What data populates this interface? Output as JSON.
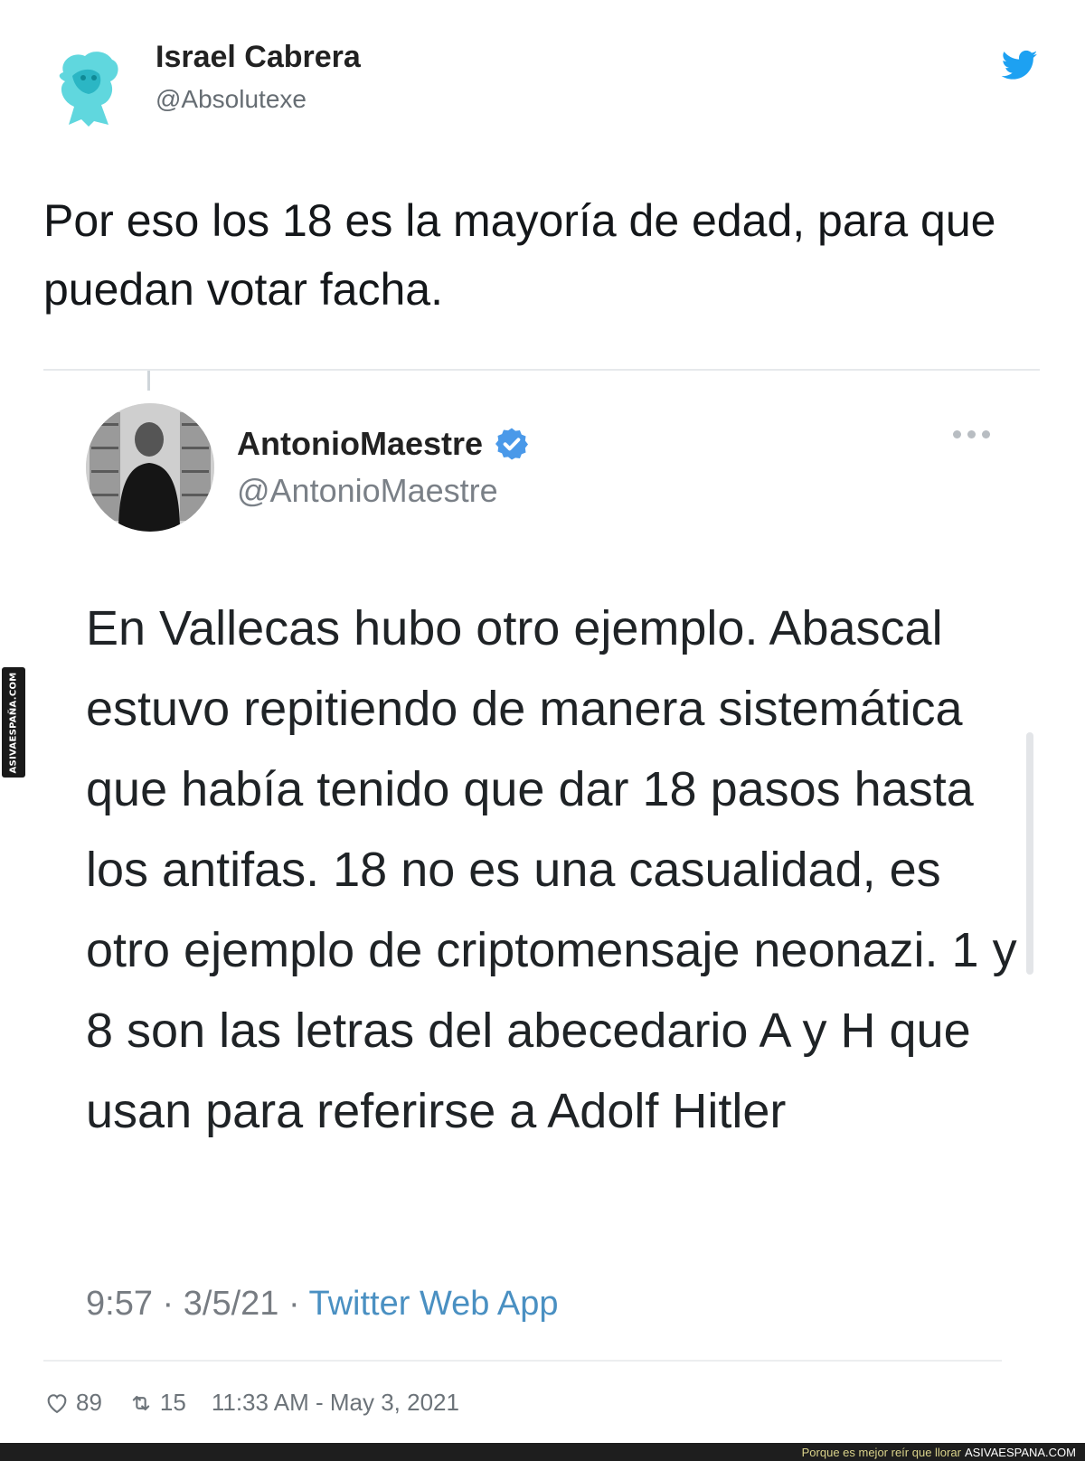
{
  "outer_tweet": {
    "name": "Israel Cabrera",
    "handle": "@Absolutexe",
    "text": "Por eso los 18 es la mayoría de edad, para que puedan votar facha.",
    "likes": "89",
    "retweets": "15",
    "timestamp": "11:33 AM - May 3, 2021"
  },
  "quoted_tweet": {
    "name": "AntonioMaestre",
    "handle": "@AntonioMaestre",
    "text": "En Vallecas hubo otro ejemplo. Abascal estuvo repitiendo de manera sistemática que había tenido que dar 18 pasos hasta los antifas. 18 no es una casualidad, es otro ejemplo de criptomensaje neonazi. 1 y 8 son las letras del abecedario A y H que usan para referirse a Adolf Hitler",
    "time": "9:57",
    "date": "3/5/21",
    "separator": "·",
    "source": "Twitter Web App"
  },
  "watermark": {
    "side": "ASIVAESPAÑA.COM",
    "footer_tagline": "Porque es mejor reír que llorar",
    "footer_site": "ASIVAESPANA.COM"
  },
  "colors": {
    "twitter_blue": "#1da1f2",
    "verified_blue": "#4a99e9",
    "link_blue": "#4a90c2"
  },
  "icons": [
    "twitter-bird-icon",
    "verified-badge-icon",
    "more-options-icon",
    "heart-icon",
    "retweet-icon"
  ]
}
